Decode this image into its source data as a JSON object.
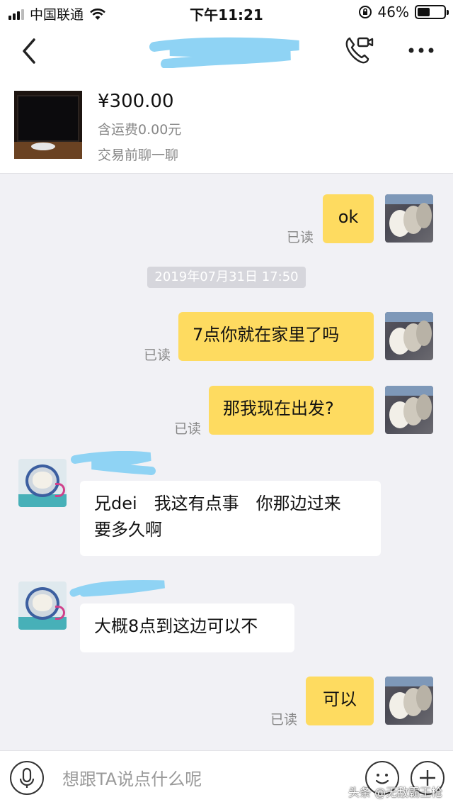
{
  "status_bar": {
    "carrier": "中国联通",
    "time": "下午11:21",
    "battery_percent": "46%",
    "battery_level": 0.46
  },
  "nav": {
    "back_icon": "chevron-left-icon",
    "video_call_icon": "video-call-icon",
    "more_icon": "more-dots-icon"
  },
  "product": {
    "price": "¥300.00",
    "shipping": "含运费0.00元",
    "subtitle": "交易前聊一聊"
  },
  "messages": {
    "m1": {
      "text": "ok",
      "status": "已读"
    },
    "timestamp": "2019年07月31日 17:50",
    "m2": {
      "text": "7点你就在家里了吗",
      "status": "已读"
    },
    "m3": {
      "text": "那我现在出发?",
      "status": "已读"
    },
    "m4": {
      "line1": "兄dei　我这有点事　你那边过来",
      "line2": "要多久啊"
    },
    "m5": {
      "text": "大概8点到这边可以不"
    },
    "m6": {
      "text": "可以",
      "status": "已读"
    }
  },
  "input_bar": {
    "placeholder": "想跟TA说点什么呢",
    "mic_icon": "microphone-icon",
    "emoji_icon": "emoji-icon",
    "plus_icon": "plus-icon"
  },
  "watermark": "头条 @无敌霸王枪",
  "colors": {
    "my_bubble": "#fedb60",
    "their_bubble": "#ffffff",
    "background": "#f1f1f5",
    "scribble": "#8fd3f4"
  }
}
